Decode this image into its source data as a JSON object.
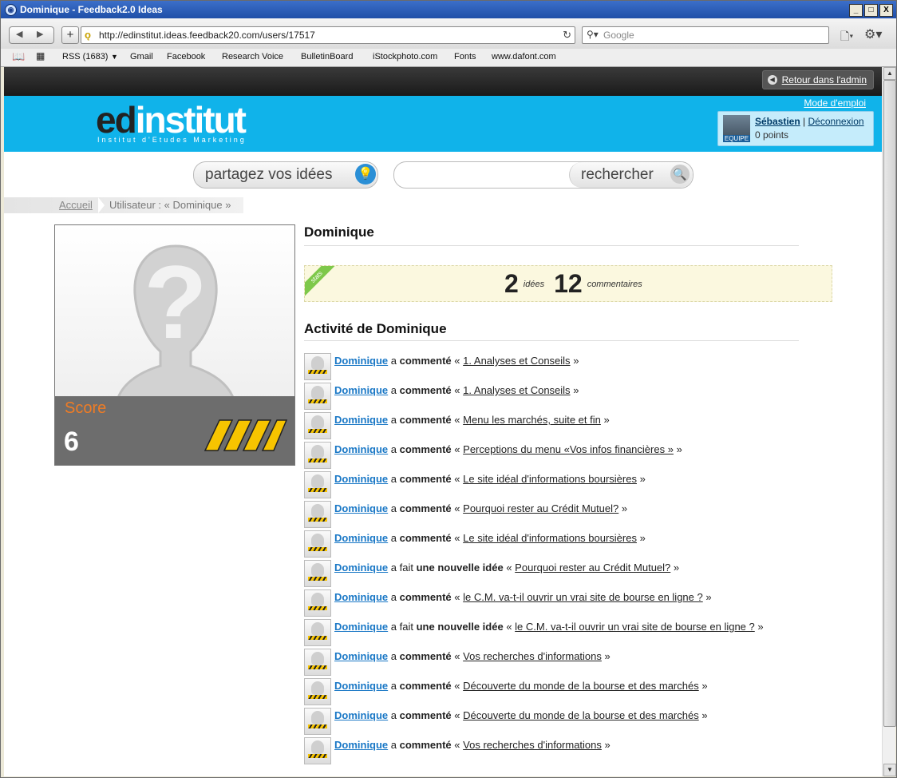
{
  "window": {
    "title": "Dominique - Feedback2.0 Ideas",
    "buttons": {
      "minimize": "_",
      "maximize": "□",
      "close": "X"
    }
  },
  "browser": {
    "url": "http://edinstitut.ideas.feedback20.com/users/17517",
    "search_placeholder": "Google",
    "bookmarks": [
      "RSS (1683)",
      "Gmail",
      "Facebook",
      "Research Voice",
      "BulletinBoard",
      "iStockphoto.com",
      "Fonts",
      "www.dafont.com"
    ]
  },
  "adminbar": {
    "back_label": "Retour dans l'admin"
  },
  "header": {
    "logo_ed": "ed",
    "logo_institut": "institut",
    "logo_tagline": "Institut d'Etudes Marketing",
    "mode_emploi": "Mode d'emploi",
    "user": {
      "name": "Sébastien",
      "separator": "|",
      "logout": "Déconnexion",
      "points": "0 points",
      "avatar_badge": "EQUIPE"
    }
  },
  "search": {
    "share_label": "partagez vos idées",
    "search_label": "rechercher"
  },
  "breadcrumb": {
    "home": "Accueil",
    "current": "Utilisateur : « Dominique »"
  },
  "profile": {
    "score_label": "Score",
    "score_value": "6",
    "score_level": 4
  },
  "main": {
    "username": "Dominique",
    "stats_ribbon": "stats",
    "ideas_count": "2",
    "ideas_label": "idées",
    "comments_count": "12",
    "comments_label": "commentaires",
    "activity_title": "Activité de Dominique"
  },
  "activity": [
    {
      "user": "Dominique",
      "verb_pre": "a ",
      "verb_bold": "commenté",
      "target": "1. Analyses et Conseils"
    },
    {
      "user": "Dominique",
      "verb_pre": "a ",
      "verb_bold": "commenté",
      "target": "1. Analyses et Conseils"
    },
    {
      "user": "Dominique",
      "verb_pre": "a ",
      "verb_bold": "commenté",
      "target": "Menu les marchés, suite et fin"
    },
    {
      "user": "Dominique",
      "verb_pre": "a ",
      "verb_bold": "commenté",
      "target": "Perceptions du menu «Vos infos financières »"
    },
    {
      "user": "Dominique",
      "verb_pre": "a ",
      "verb_bold": "commenté",
      "target": "Le site idéal d'informations boursières"
    },
    {
      "user": "Dominique",
      "verb_pre": "a ",
      "verb_bold": "commenté",
      "target": "Pourquoi rester au Crédit Mutuel?"
    },
    {
      "user": "Dominique",
      "verb_pre": "a ",
      "verb_bold": "commenté",
      "target": "Le site idéal d'informations boursières"
    },
    {
      "user": "Dominique",
      "verb_pre": "a fait ",
      "verb_bold": "une nouvelle idée",
      "target": "Pourquoi rester au Crédit Mutuel?"
    },
    {
      "user": "Dominique",
      "verb_pre": "a ",
      "verb_bold": "commenté",
      "target": "le C.M. va-t-il ouvrir un vrai site de bourse en ligne ?"
    },
    {
      "user": "Dominique",
      "verb_pre": "a fait ",
      "verb_bold": "une nouvelle idée",
      "target": "le C.M. va-t-il ouvrir un vrai site de bourse en ligne ?"
    },
    {
      "user": "Dominique",
      "verb_pre": "a ",
      "verb_bold": "commenté",
      "target": "Vos recherches d'informations"
    },
    {
      "user": "Dominique",
      "verb_pre": "a ",
      "verb_bold": "commenté",
      "target": "Découverte du monde de la bourse et des marchés"
    },
    {
      "user": "Dominique",
      "verb_pre": "a ",
      "verb_bold": "commenté",
      "target": "Découverte du monde de la bourse et des marchés"
    },
    {
      "user": "Dominique",
      "verb_pre": "a ",
      "verb_bold": "commenté",
      "target": "Vos recherches d'informations"
    }
  ],
  "colors": {
    "header_blue": "#10b3ea",
    "score_orange": "#f07c24",
    "link_blue": "#1a78c6",
    "stats_bg": "#fbf8df",
    "ribbon_green": "#7ec84a"
  }
}
